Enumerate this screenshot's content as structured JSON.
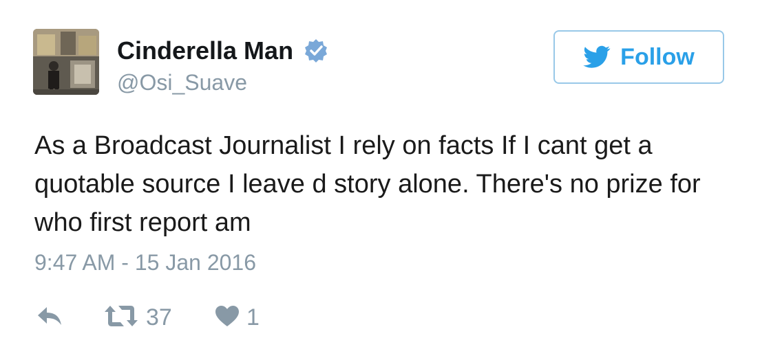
{
  "user": {
    "display_name": "Cinderella Man",
    "handle": "@Osi_Suave",
    "verified": true
  },
  "follow_button": {
    "label": "Follow"
  },
  "tweet": {
    "text": "As a Broadcast Journalist I rely on facts If I cant get a quotable source I leave d story alone. There's no prize for who first report am",
    "timestamp": "9:47 AM - 15 Jan 2016"
  },
  "actions": {
    "retweet_count": "37",
    "like_count": "1"
  },
  "colors": {
    "accent": "#2aa0e8",
    "muted": "#8899a6",
    "verified_badge": "#7aa8d8"
  },
  "icons": {
    "reply": "reply-icon",
    "retweet": "retweet-icon",
    "like": "heart-icon",
    "verified": "verified-badge-icon",
    "follow": "twitter-bird-icon"
  }
}
